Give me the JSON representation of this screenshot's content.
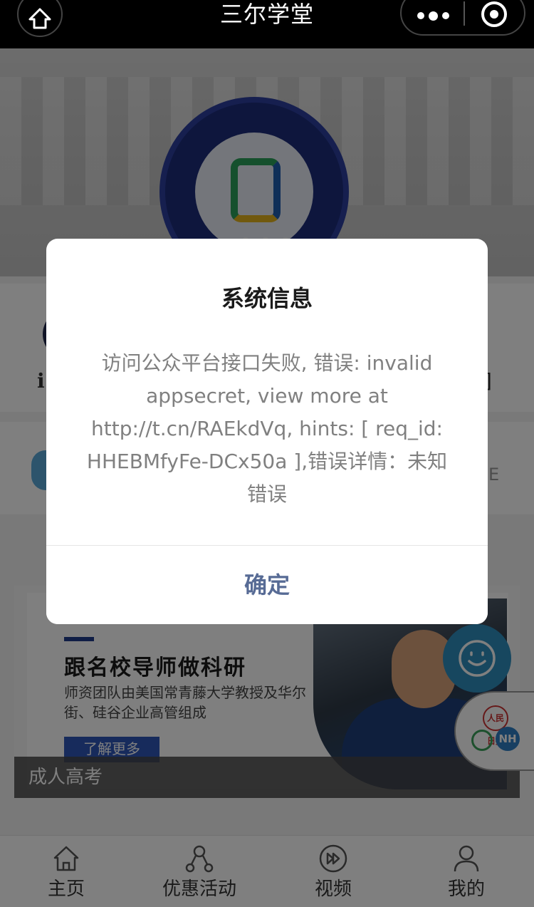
{
  "navbar": {
    "title": "三尔学堂",
    "home_icon": "home-icon",
    "more_icon": "more-dots-icon",
    "close_icon": "target-close-icon"
  },
  "promo": {
    "title": "跟名校导师做科研",
    "subtitle": "师资团队由美国常青藤大学教授及华尔街、硅谷企业高管组成",
    "button_label": "了解更多",
    "caption": "成人高考",
    "accent_color": "#2f57b9"
  },
  "partial": {
    "row1_left": "ℹ",
    "row1_right": "]",
    "row2_right": "E"
  },
  "float": {
    "seal_text": "人民日报",
    "nh_text": "NH"
  },
  "tabbar": {
    "items": [
      {
        "label": "主页",
        "icon": "home-outline-icon"
      },
      {
        "label": "优惠活动",
        "icon": "share-nodes-icon"
      },
      {
        "label": "视频",
        "icon": "play-forward-icon"
      },
      {
        "label": "我的",
        "icon": "user-icon"
      }
    ]
  },
  "modal": {
    "title": "系统信息",
    "message": "访问公众平台接口失败, 错误: invalid appsecret, view more at http://t.cn/RAEkdVq, hints: [ req_id: HHEBMfyFe-DCx50a ],错误详情：未知错误",
    "confirm_label": "确定",
    "confirm_color": "#576b95"
  }
}
